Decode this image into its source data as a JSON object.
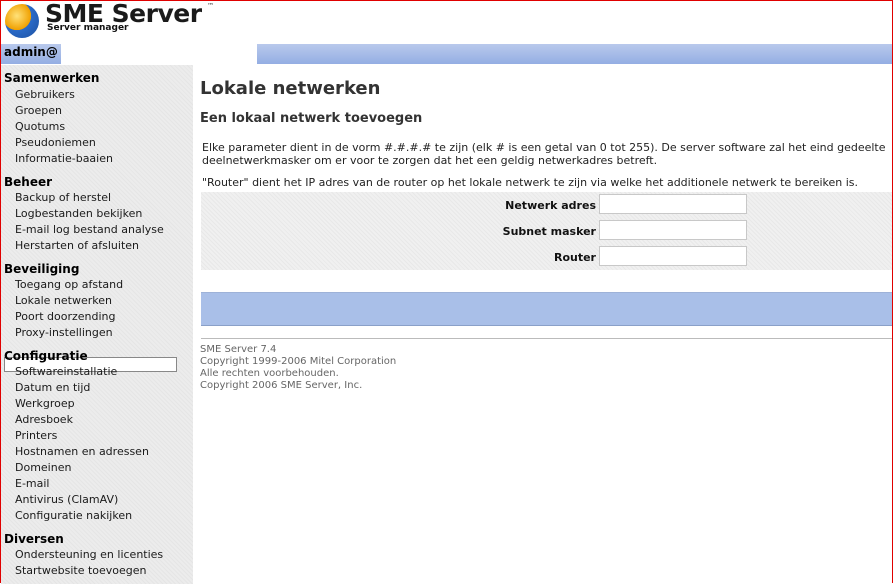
{
  "header": {
    "title": "SME Server",
    "subtitle": "Server manager",
    "trademark": "™"
  },
  "user": {
    "name": "admin@"
  },
  "sidebar": {
    "sections": [
      {
        "heading": "Samenwerken",
        "items": [
          "Gebruikers",
          "Groepen",
          "Quotums",
          "Pseudoniemen",
          "Informatie-baaien"
        ]
      },
      {
        "heading": "Beheer",
        "items": [
          "Backup of herstel",
          "Logbestanden bekijken",
          "E-mail log bestand analyse",
          "Herstarten of afsluiten"
        ]
      },
      {
        "heading": "Beveiliging",
        "items": [
          "Toegang op afstand",
          "Lokale netwerken",
          "Poort doorzending",
          "Proxy-instellingen"
        ]
      },
      {
        "heading": "Configuratie",
        "items": [
          "Softwareinstallatie",
          "Datum en tijd",
          "Werkgroep",
          "Adresboek",
          "Printers",
          "Hostnamen en adressen",
          "Domeinen",
          "E-mail",
          "Antivirus (ClamAV)",
          "Configuratie nakijken"
        ]
      },
      {
        "heading": "Diversen",
        "items": [
          "Ondersteuning en licenties",
          "Startwebsite toevoegen"
        ]
      }
    ],
    "active_item": "Lokale netwerken"
  },
  "main": {
    "title": "Lokale netwerken",
    "subtitle": "Een lokaal netwerk toevoegen",
    "para1_line1": "Elke parameter dient in de vorm #.#.#.# te zijn (elk # is een getal van 0 tot 255). De server software zal het eind gedeelte",
    "para1_line2": "deelnetwerkmasker om er voor te zorgen dat het een geldig netwerkadres betreft.",
    "para2": "\"Router\" dient het IP adres van de router op het lokale netwerk te zijn via welke het additionele netwerk te bereiken is.",
    "form": {
      "network_label": "Netwerk adres",
      "network_value": "",
      "subnet_label": "Subnet masker",
      "subnet_value": "",
      "router_label": "Router",
      "router_value": ""
    }
  },
  "footer": {
    "line1": "SME Server 7.4",
    "line2": "Copyright 1999-2006 Mitel Corporation",
    "line3": "Alle rechten voorbehouden.",
    "line4": "Copyright 2006 SME Server, Inc."
  }
}
